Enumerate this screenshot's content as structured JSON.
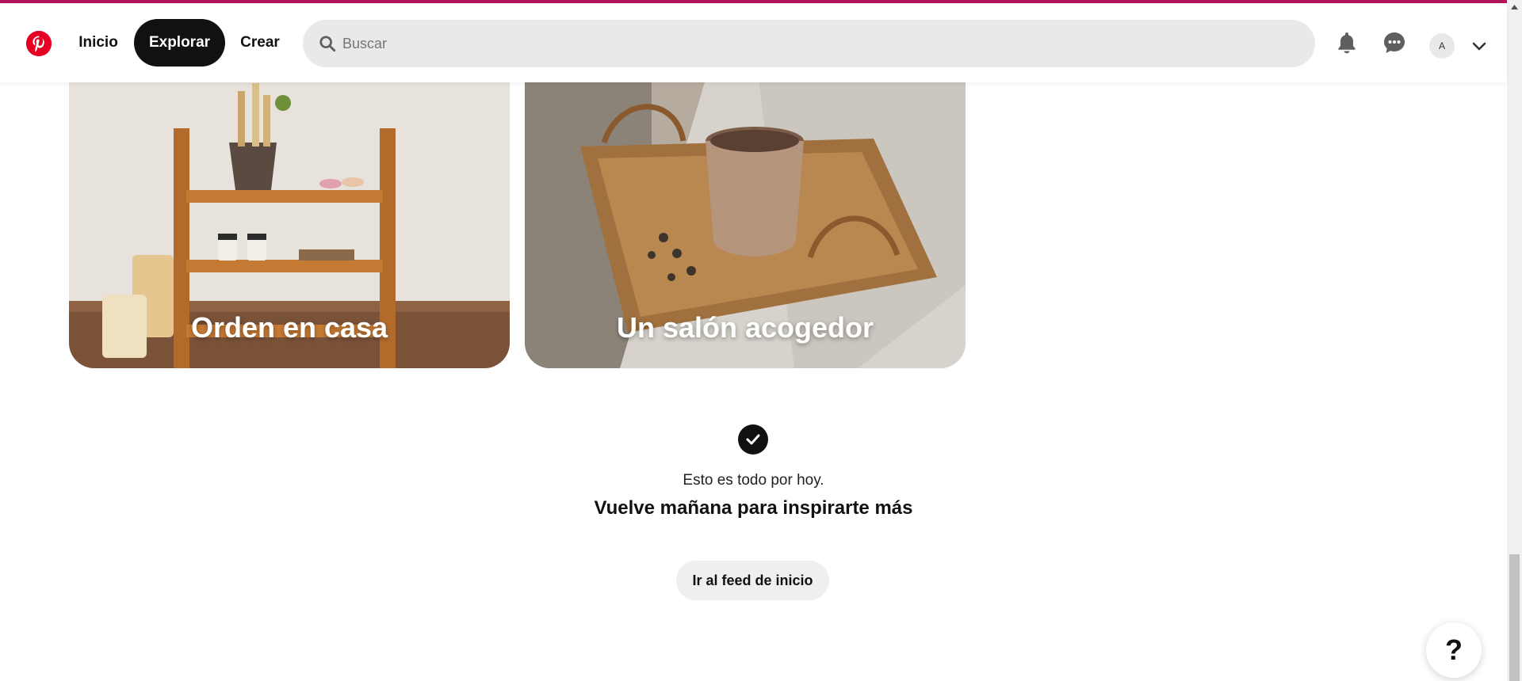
{
  "header": {
    "logo": "pinterest-logo",
    "nav": {
      "home_label": "Inicio",
      "explore_label": "Explorar",
      "create_label": "Crear"
    },
    "search": {
      "placeholder": "Buscar",
      "value": ""
    },
    "icons": [
      "bell-icon",
      "messages-icon"
    ],
    "avatar_initial": "A"
  },
  "cards": [
    {
      "title": "Orden en casa"
    },
    {
      "title": "Un salón acogedor"
    }
  ],
  "end_message": {
    "small": "Esto es todo por hoy.",
    "big": "Vuelve mañana para inspirarte más",
    "button_label": "Ir al feed de inicio"
  },
  "help_button": "?",
  "colors": {
    "accent_bar": "#b4145a",
    "brand_red": "#e60023",
    "active_nav_bg": "#111111",
    "search_bg": "#e9e9e9",
    "button_bg": "#efefef"
  }
}
